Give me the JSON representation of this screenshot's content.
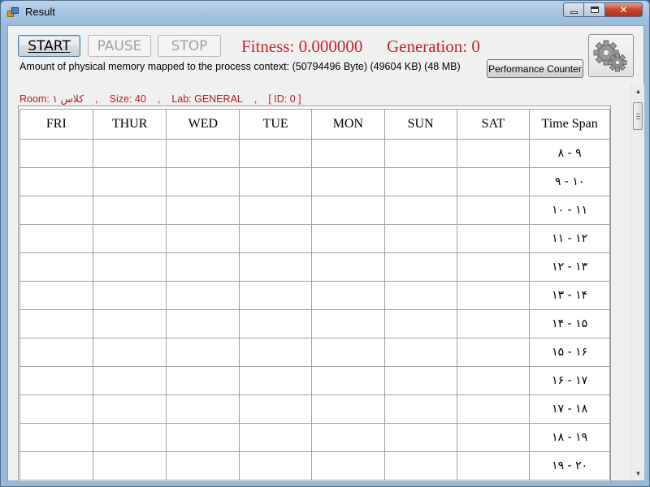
{
  "window": {
    "title": "Result"
  },
  "toolbar": {
    "start_label": "START",
    "pause_label": "PAUSE",
    "stop_label": "STOP",
    "fitness": "Fitness: 0.000000",
    "generation": "Generation: 0",
    "memory": "Amount of physical memory mapped to the process context:  (50794496 Byte)   (49604 KB)   (48 MB)",
    "perf_counter_label": "Performance Counter",
    "settings_icon": "gear-icon"
  },
  "room": {
    "room": "Room: کلاس ۱",
    "size": "Size: 40",
    "lab": "Lab: GENERAL",
    "id": "[ ID: 0 ]",
    "sep1": ",",
    "sep2": ",",
    "sep3": ","
  },
  "schedule": {
    "headers": [
      "FRI",
      "THUR",
      "WED",
      "TUE",
      "MON",
      "SUN",
      "SAT",
      "Time Span"
    ],
    "time_spans": [
      "۸ - ۹",
      "۹ - ۱۰",
      "۱۰ - ۱۱",
      "۱۱ - ۱۲",
      "۱۲ - ۱۳",
      "۱۳ - ۱۴",
      "۱۴ - ۱۵",
      "۱۵ - ۱۶",
      "۱۶ - ۱۷",
      "۱۷ - ۱۸",
      "۱۸ - ۱۹",
      "۱۹ - ۲۰"
    ]
  },
  "colors": {
    "accent_red": "#d0202e",
    "room_text": "#b31c1c"
  }
}
